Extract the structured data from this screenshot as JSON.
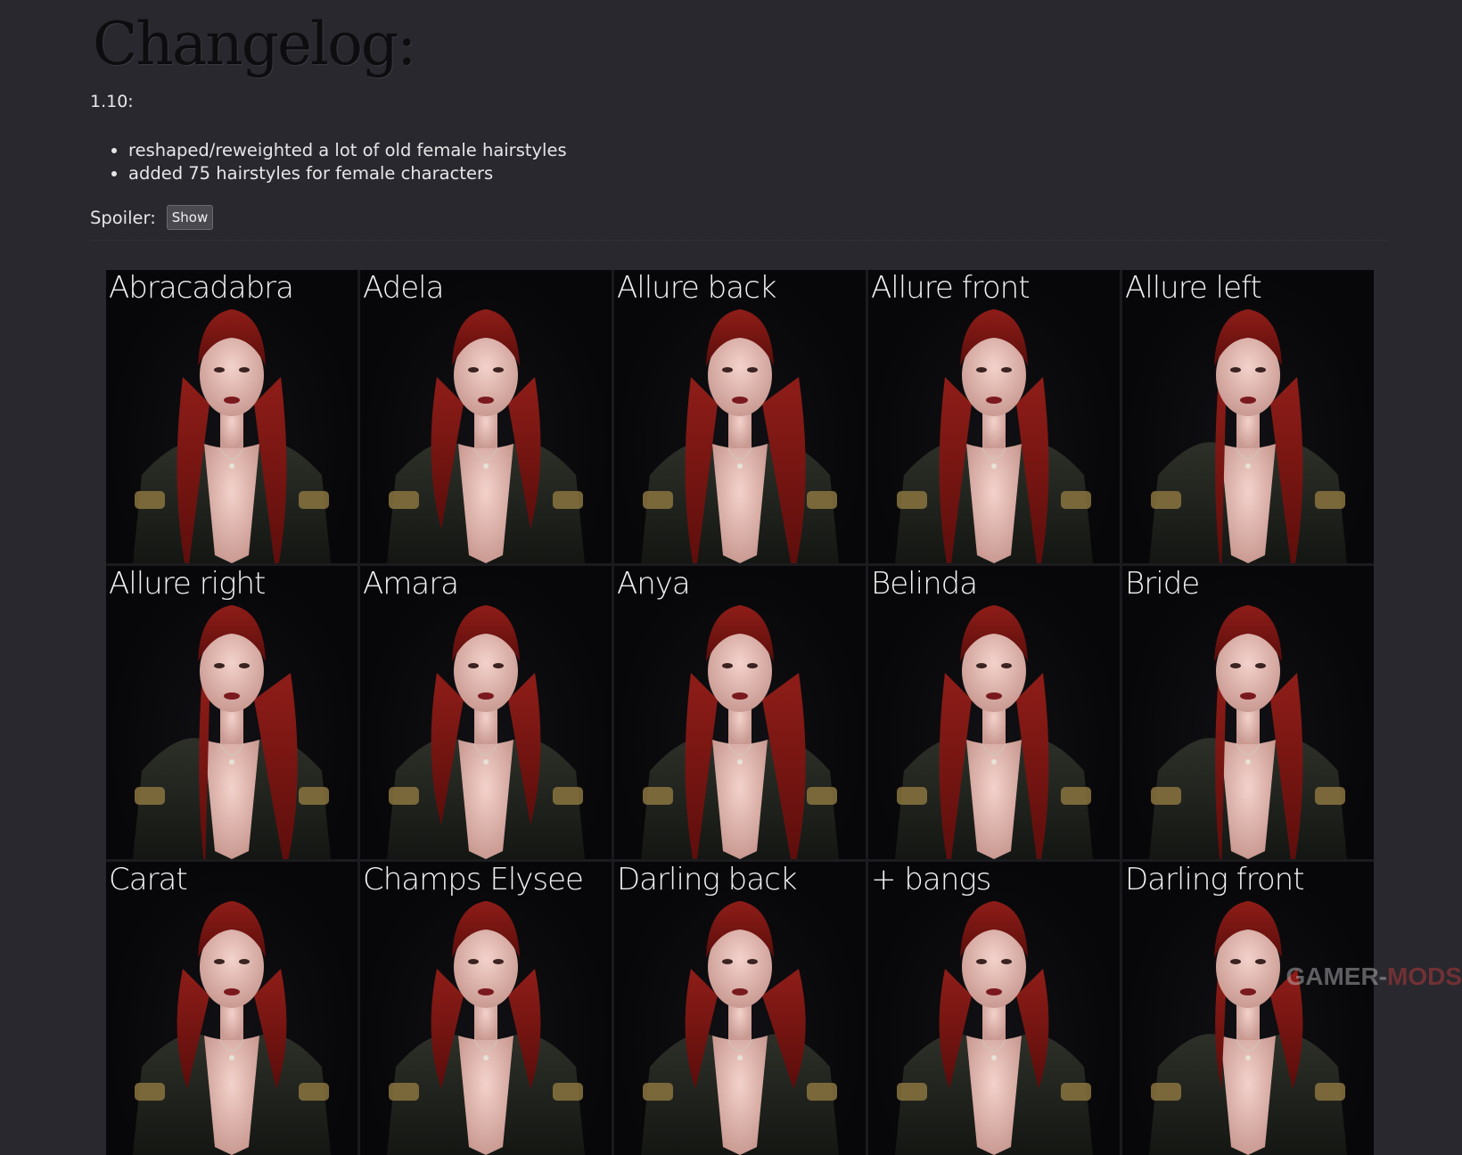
{
  "changelog": {
    "heading": "Changelog:",
    "version": "1.10:",
    "items": [
      "reshaped/reweighted a lot of old female hairstyles",
      "added 75 hairstyles for female characters"
    ],
    "spoiler_label": "Spoiler:",
    "spoiler_button": "Show"
  },
  "hairstyles": [
    "Abracadabra",
    "Adela",
    "Allure back",
    "Allure front",
    "Allure left",
    "Allure right",
    "Amara",
    "Anya",
    "Belinda",
    "Bride",
    "Carat",
    "Champs Elysee",
    "Darling back",
    "+ bangs",
    "Darling front"
  ],
  "watermark": {
    "part1": "GAMER-",
    "part2": "MODS"
  }
}
